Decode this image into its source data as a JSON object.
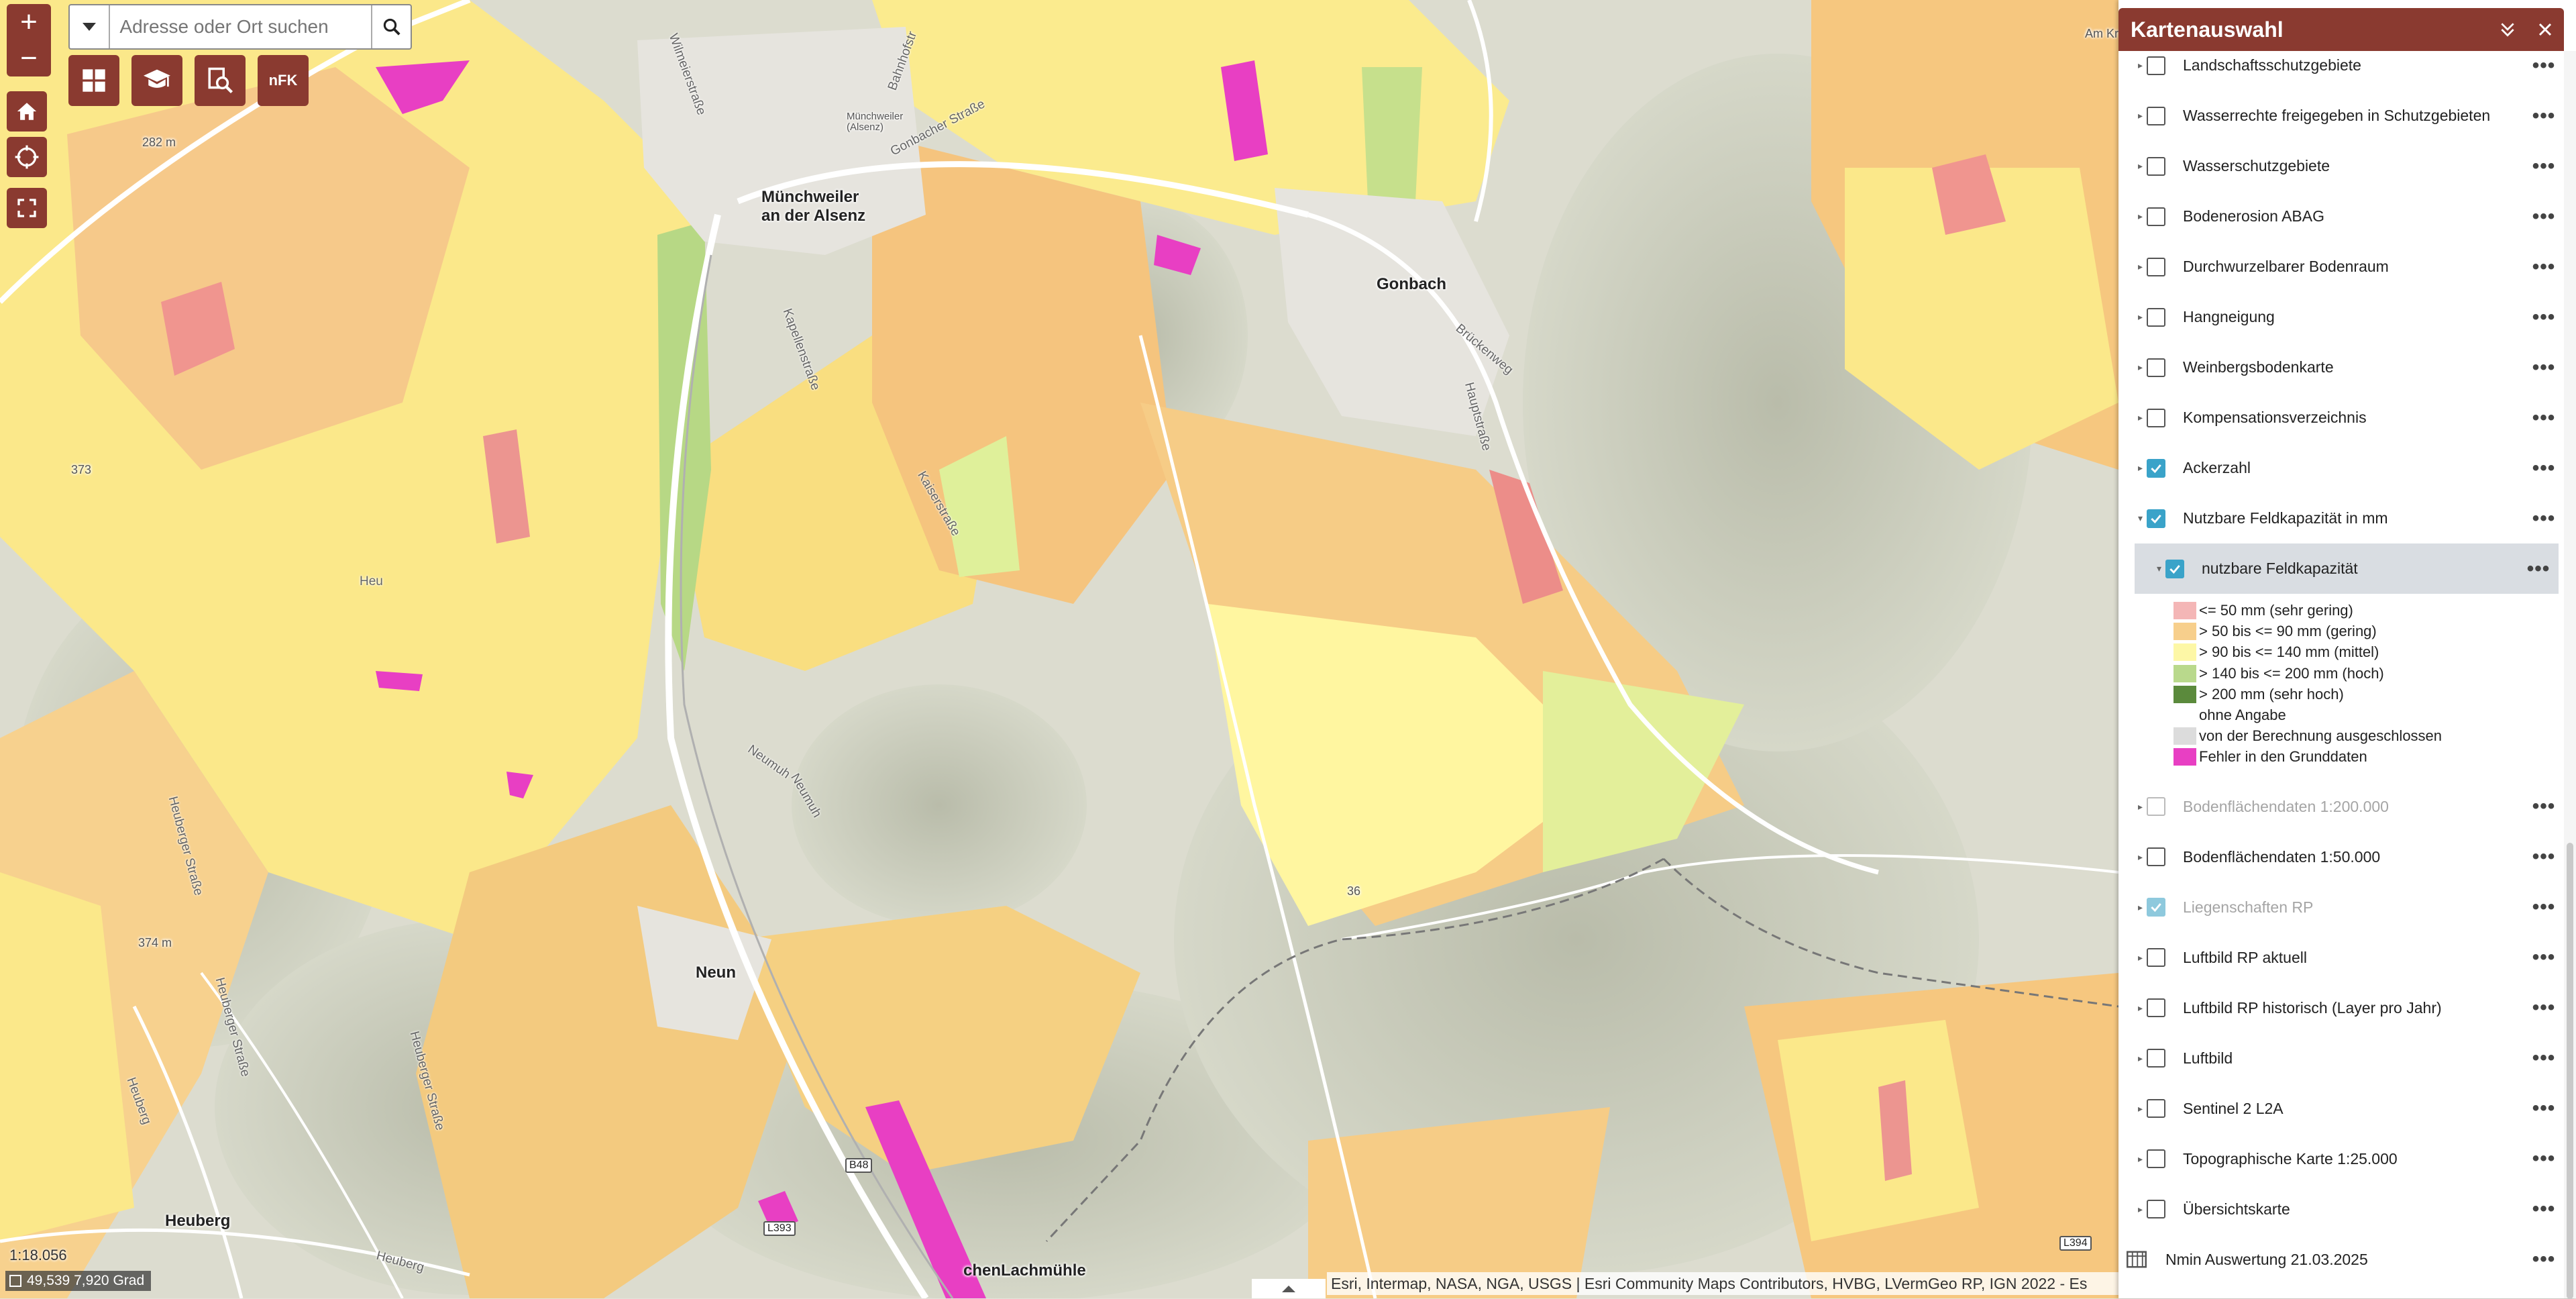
{
  "search": {
    "placeholder": "Adresse oder Ort suchen"
  },
  "toolbar": {
    "nfk_label": "nFK"
  },
  "map": {
    "labels": {
      "muenchweiler_1": "Münchweiler",
      "muenchweiler_2": "an der Alsenz",
      "muenchweiler_small_1": "Münchweiler",
      "muenchweiler_small_2": "(Alsenz)",
      "gonbach": "Gonbach",
      "neun": "Neun",
      "heuberg": "Heuberg",
      "lachmuehle": "chenLachmühle",
      "am_kr": "Am Kr"
    },
    "elevations": {
      "e282": "282 m",
      "e374": "374 m",
      "e373": "373",
      "e36": "36"
    },
    "roads": {
      "gonbacher": "Gonbacher Straße",
      "bahnhof": "Bahnhofstr",
      "wilme": "Wilmeierstraße",
      "kapellen": "Kapellenstraße",
      "bruecken": "Brückenweg",
      "haupt": "Hauptstraße",
      "neumuehle1": "Neumuh",
      "neumuehle2": "Neumuh",
      "heuberger1": "Heuberger Straße",
      "heuberger2": "Heuberger Straße",
      "heuberger3": "Heuberger Straße",
      "heuberg_r": "Heuberg",
      "heuberg_r2": "Heuberg",
      "heu": "Heu",
      "kaiserslautern": "Kaiserstraße"
    },
    "shields": {
      "b48": "B48",
      "l393": "L393",
      "l394": "L394"
    }
  },
  "status": {
    "scale": "1:18.056",
    "coords": "49,539 7,920 Grad",
    "attribution": "Esri, Intermap, NASA, NGA, USGS | Esri Community Maps Contributors, HVBG, LVermGeo RP, IGN 2022 - Es"
  },
  "panel": {
    "title": "Kartenauswahl",
    "layers": [
      {
        "label": "Landschaftsschutzgebiete",
        "checked": false,
        "dim": false
      },
      {
        "label": "Wasserrechte freigegeben in Schutzgebieten",
        "checked": false,
        "dim": false
      },
      {
        "label": "Wasserschutzgebiete",
        "checked": false,
        "dim": false
      },
      {
        "label": "Bodenerosion ABAG",
        "checked": false,
        "dim": false
      },
      {
        "label": "Durchwurzelbarer Bodenraum",
        "checked": false,
        "dim": false
      },
      {
        "label": "Hangneigung",
        "checked": false,
        "dim": false
      },
      {
        "label": "Weinbergsbodenkarte",
        "checked": false,
        "dim": false
      },
      {
        "label": "Kompensationsverzeichnis",
        "checked": false,
        "dim": false
      },
      {
        "label": "Ackerzahl",
        "checked": true,
        "dim": false
      },
      {
        "label": "Nutzbare Feldkapazität in mm",
        "checked": true,
        "dim": false
      }
    ],
    "sublayer": {
      "label": "nutzbare Feldkapazität",
      "checked": true
    },
    "legend": [
      {
        "label": "<= 50 mm (sehr gering)",
        "color": "#f4b6b6"
      },
      {
        "label": "> 50 bis <= 90 mm (gering)",
        "color": "#f7cf8c"
      },
      {
        "label": "> 90 bis <= 140 mm (mittel)",
        "color": "#fdf7a6"
      },
      {
        "label": "> 140 bis <= 200 mm (hoch)",
        "color": "#b9d98c"
      },
      {
        "label": "> 200 mm (sehr hoch)",
        "color": "#5b8a3c"
      },
      {
        "label": "ohne Angabe",
        "color": "#ffffff"
      },
      {
        "label": "von der Berechnung ausgeschlossen",
        "color": "#dcdcdc"
      },
      {
        "label": "Fehler in den Grunddaten",
        "color": "#e83fc3"
      }
    ],
    "layers2": [
      {
        "label": "Bodenflächendaten 1:200.000",
        "checked": false,
        "dim": true
      },
      {
        "label": "Bodenflächendaten 1:50.000",
        "checked": false,
        "dim": false
      },
      {
        "label": "Liegenschaften RP",
        "checked": true,
        "dim": true
      },
      {
        "label": "Luftbild RP aktuell",
        "checked": false,
        "dim": false
      },
      {
        "label": "Luftbild RP historisch (Layer pro Jahr)",
        "checked": false,
        "dim": false
      },
      {
        "label": "Luftbild",
        "checked": false,
        "dim": false
      },
      {
        "label": "Sentinel 2 L2A",
        "checked": false,
        "dim": false
      },
      {
        "label": "Topographische Karte 1:25.000",
        "checked": false,
        "dim": false
      },
      {
        "label": "Übersichtskarte",
        "checked": false,
        "dim": false
      }
    ],
    "table_layer": {
      "label": "Nmin Auswertung 21.03.2025"
    }
  }
}
